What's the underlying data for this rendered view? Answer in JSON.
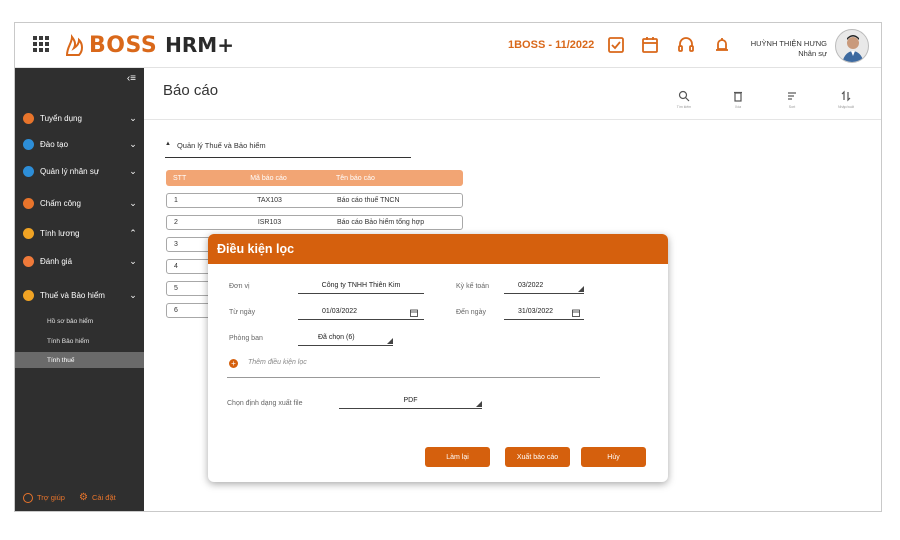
{
  "topbar": {
    "brand": "BOSS",
    "product": "HRM+",
    "period": "1BOSS - 11/2022",
    "user_name": "HUỲNH THIỆN HƯNG",
    "user_role": "Nhân sự",
    "icons": [
      "checkbox-icon",
      "calendar-icon",
      "headset-icon",
      "bell-icon"
    ],
    "accent": "#d9681a"
  },
  "sidebar": {
    "items": [
      {
        "label": "Tuyển dụng",
        "chevron": "down"
      },
      {
        "label": "Đào tạo",
        "chevron": "down"
      },
      {
        "label": "Quản lý nhân sự",
        "chevron": "down"
      },
      {
        "label": "Chấm công",
        "chevron": "down"
      },
      {
        "label": "Tính lương",
        "chevron": "up"
      },
      {
        "label": "Đánh giá",
        "chevron": "down"
      },
      {
        "label": "Thuế và Bảo hiểm",
        "chevron": "down"
      }
    ],
    "sub_items": [
      {
        "label": "Hồ sơ bảo hiểm",
        "active": false
      },
      {
        "label": "Tính Bảo hiểm",
        "active": false
      },
      {
        "label": "Tính thuế",
        "active": true
      }
    ],
    "help": "Trợ giúp",
    "settings": "Cài đặt"
  },
  "main": {
    "title": "Báo cáo",
    "actions": [
      {
        "label": "Tìm kiếm",
        "icon": "search-icon"
      },
      {
        "label": "Xóa",
        "icon": "trash-icon"
      },
      {
        "label": "Sort",
        "icon": "sort-icon"
      },
      {
        "label": "Nhập/xuất",
        "icon": "import-export-icon"
      }
    ],
    "section": "Quản lý Thuế và Bảo hiểm",
    "table": {
      "headers": [
        "STT",
        "Mã báo cáo",
        "Tên báo cáo"
      ],
      "rows": [
        {
          "stt": "1",
          "code": "TAX103",
          "name": "Báo cáo thuế TNCN"
        },
        {
          "stt": "2",
          "code": "ISR103",
          "name": "Báo cáo Bảo hiểm tổng hợp"
        },
        {
          "stt": "3",
          "code": "",
          "name": ""
        },
        {
          "stt": "4",
          "code": "",
          "name": ""
        },
        {
          "stt": "5",
          "code": "",
          "name": ""
        },
        {
          "stt": "6",
          "code": "",
          "name": ""
        }
      ]
    }
  },
  "dialog": {
    "title": "Điều kiện lọc",
    "unit_label": "Đơn vị",
    "unit_value": "Công ty TNHH Thiên Kim",
    "period_label": "Kỳ kế toán",
    "period_value": "03/2022",
    "from_label": "Từ ngày",
    "from_value": "01/03/2022",
    "to_label": "Đến ngày",
    "to_value": "31/03/2022",
    "dept_label": "Phòng ban",
    "dept_value": "Đã chọn (6)",
    "add_condition": "Thêm điều kiện lọc",
    "format_label": "Chọn định dạng xuất file",
    "format_value": "PDF",
    "btn_reset": "Làm lại",
    "btn_export": "Xuất báo cáo",
    "btn_cancel": "Hủy"
  }
}
